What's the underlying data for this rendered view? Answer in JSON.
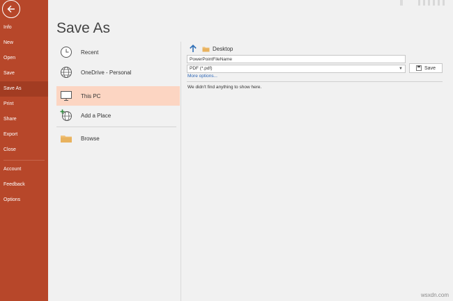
{
  "nav": {
    "items": [
      "Info",
      "New",
      "Open",
      "Save",
      "Save As",
      "Print",
      "Share",
      "Export",
      "Close",
      "Account",
      "Feedback",
      "Options"
    ],
    "active": "Save As"
  },
  "page": {
    "title": "Save As"
  },
  "locations": {
    "items": [
      {
        "label": "Recent",
        "icon": "clock-icon"
      },
      {
        "label": "OneDrive - Personal",
        "icon": "globe-icon"
      },
      {
        "label": "This PC",
        "icon": "computer-icon",
        "selected": true
      },
      {
        "label": "Add a Place",
        "icon": "add-place-icon"
      },
      {
        "label": "Browse",
        "icon": "folder-icon"
      }
    ]
  },
  "file_pane": {
    "breadcrumb": "Desktop",
    "filename_value": "PowerPointFileName",
    "filetype_value": "PDF (*.pdf)",
    "save_label": "Save",
    "more_options": "More options...",
    "empty_message": "We didn't find anything to show here."
  },
  "watermark": "wsxdn.com",
  "colors": {
    "accent": "#b7472a",
    "selected": "#fcd5c2",
    "link": "#2b65b5"
  }
}
